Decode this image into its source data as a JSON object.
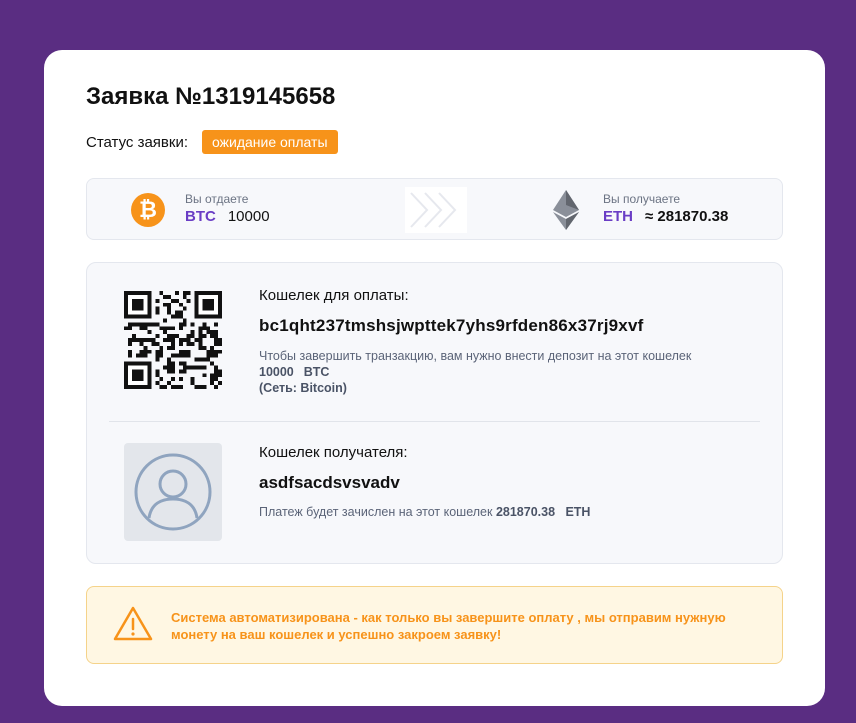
{
  "order": {
    "title": "Заявка №1319145658",
    "status_label": "Статус заявки:",
    "status_value": "ожидание оплаты",
    "status_color": "#f7931a"
  },
  "exchange": {
    "give_label": "Вы отдаете",
    "give_ticker": "BTC",
    "give_amount": "10000",
    "give_icon": "bitcoin-icon",
    "get_label": "Вы получаете",
    "get_ticker": "ETH",
    "get_amount": "≈ 281870.38",
    "get_icon": "ethereum-icon",
    "arrows_icon": "chevrons-right-icon"
  },
  "payment_wallet": {
    "label": "Кошелек для оплаты:",
    "address": "bc1qht237tmshsjwpttek7yhs9rfden86x37rj9xvf",
    "note": "Чтобы завершить транзакцию, вам нужно внести депозит на этот кошелек",
    "amount": "10000",
    "ticker": "BTC",
    "network": "(Сеть: Bitcoin)",
    "qr_icon": "qr-code-icon"
  },
  "recipient_wallet": {
    "label": "Кошелек получателя:",
    "address": "asdfsacdsvsvadv",
    "note_prefix": "Платеж будет зачислен на этот кошелек",
    "amount": "281870.38",
    "ticker": "ETH",
    "avatar_icon": "user-avatar-icon"
  },
  "alert": {
    "text": "Система автоматизирована - как только вы завершите оплату , мы отправим нужную монету на ваш кошелек и успешно закроем заявку!",
    "icon": "warning-icon",
    "color": "#f7931a"
  },
  "colors": {
    "background": "#5a2d82",
    "accent_ticker": "#6a3dc5",
    "btc": "#f7931a"
  }
}
